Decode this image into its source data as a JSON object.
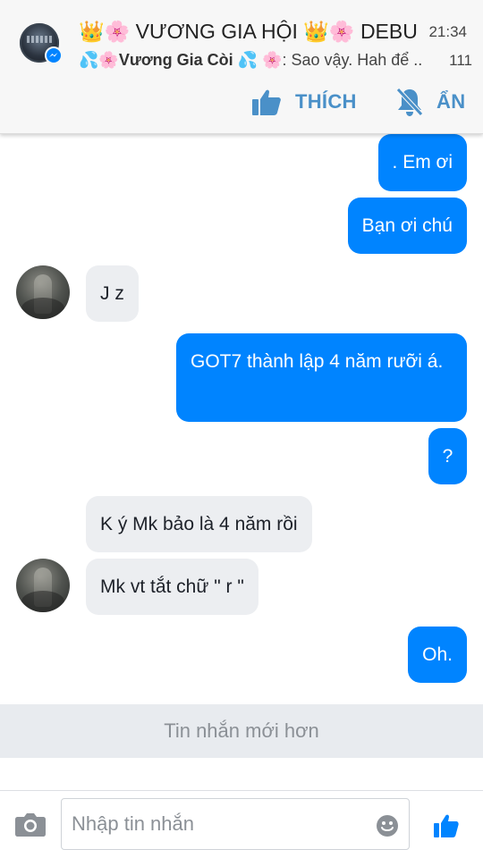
{
  "notification": {
    "title": "👑🌸 VƯƠNG GIA HỘI 👑🌸 DEBU..",
    "time": "21:34",
    "preview_sender": "💦🌸Vương Gia Còi 💦 🌸",
    "preview_text": ": Sao vậy. Hah để ..",
    "count": "111",
    "like_label": "THÍCH",
    "hide_label": "ẨN",
    "accent_color": "#4a90c8"
  },
  "messages": [
    {
      "direction": "outgoing",
      "text": ". Em ơi"
    },
    {
      "direction": "outgoing",
      "text": "Bạn ơi chú"
    },
    {
      "direction": "incoming",
      "text": "J z",
      "avatar": true
    },
    {
      "direction": "outgoing",
      "text": "GOT7 thành lập 4 năm rưỡi á."
    },
    {
      "direction": "outgoing",
      "text": "?"
    },
    {
      "direction": "incoming",
      "text": "K ý Mk bảo là 4 năm rồi",
      "avatar": false
    },
    {
      "direction": "incoming",
      "text": "Mk vt tắt chữ \" r \"",
      "avatar": true
    },
    {
      "direction": "outgoing",
      "text": "Oh."
    }
  ],
  "newer_messages_label": "Tin nhắn mới hơn",
  "composer": {
    "placeholder": "Nhập tin nhắn",
    "value": "",
    "icons": [
      "camera-icon",
      "emoji-icon",
      "like-icon"
    ]
  },
  "colors": {
    "outgoing_bubble": "#0084ff",
    "incoming_bubble": "#eceef1",
    "newer_bar": "#e8ebef",
    "messenger_blue": "#0084ff"
  }
}
